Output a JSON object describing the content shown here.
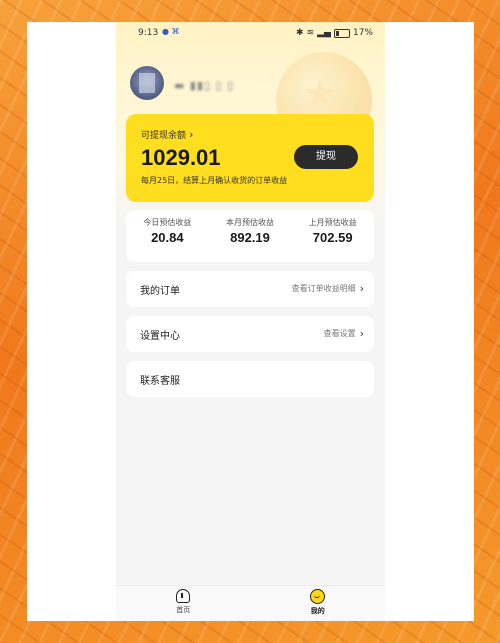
{
  "status_bar": {
    "time": "9:13",
    "battery": "17%"
  },
  "profile": {
    "username": "▬ ▮▮▯ ▯ ▯"
  },
  "balance": {
    "title": "可提现余额",
    "amount": "1029.01",
    "withdraw_label": "提现",
    "note": "每月25日，结算上月确认收货的订单收益"
  },
  "stats": [
    {
      "label": "今日预估收益",
      "value": "20.84"
    },
    {
      "label": "本月预估收益",
      "value": "892.19"
    },
    {
      "label": "上月预估收益",
      "value": "702.59"
    }
  ],
  "menu": {
    "orders": {
      "label": "我的订单",
      "link": "查看订单收益明细"
    },
    "settings": {
      "label": "设置中心",
      "link": "查看设置"
    },
    "support": {
      "label": "联系客服"
    }
  },
  "tabbar": {
    "home": "首页",
    "me": "我的"
  },
  "colors": {
    "accent_yellow": "#ffdd1f",
    "button_dark": "#2b2b2b",
    "frame_orange": "#f3821a"
  },
  "icons": [
    "home-icon",
    "me-icon",
    "chevron-right-icon",
    "wifi-icon",
    "battery-icon",
    "bluetooth-icon"
  ]
}
